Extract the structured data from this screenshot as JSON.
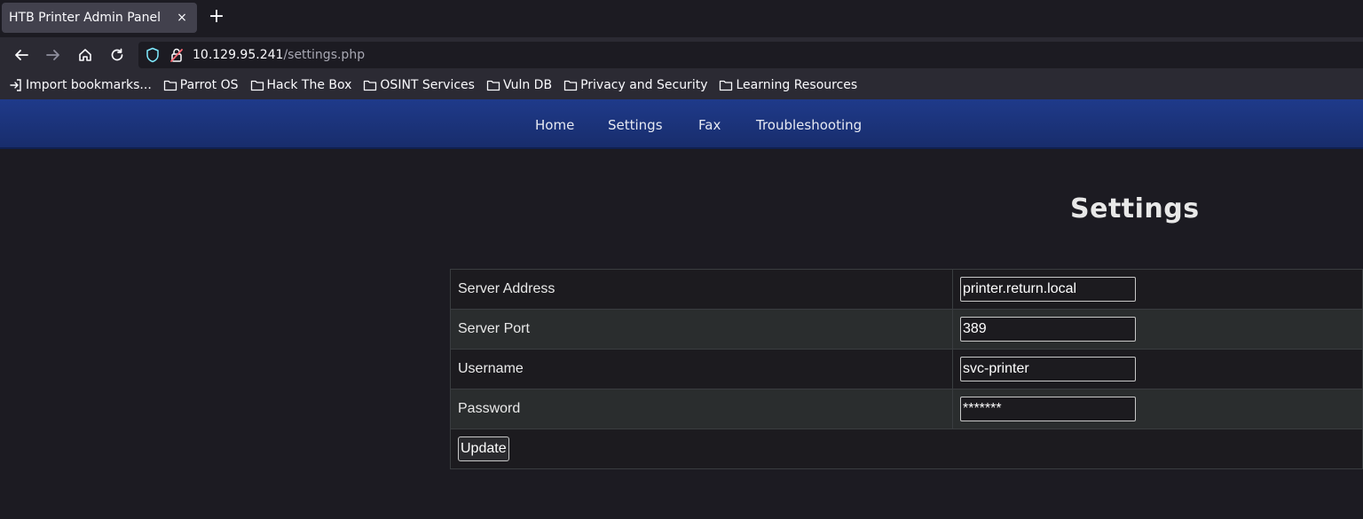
{
  "browser": {
    "tab_title": "HTB Printer Admin Panel",
    "tab_close": "×",
    "new_tab": "+",
    "url_host": "10.129.95.241",
    "url_path": "/settings.php"
  },
  "bookmarks": [
    {
      "label": "Import bookmarks...",
      "icon": "import-icon"
    },
    {
      "label": "Parrot OS",
      "icon": "folder-icon"
    },
    {
      "label": "Hack The Box",
      "icon": "folder-icon"
    },
    {
      "label": "OSINT Services",
      "icon": "folder-icon"
    },
    {
      "label": "Vuln DB",
      "icon": "folder-icon"
    },
    {
      "label": "Privacy and Security",
      "icon": "folder-icon"
    },
    {
      "label": "Learning Resources",
      "icon": "folder-icon"
    }
  ],
  "site_nav": {
    "home": "Home",
    "settings": "Settings",
    "fax": "Fax",
    "troubleshooting": "Troubleshooting"
  },
  "page": {
    "title": "Settings"
  },
  "form": {
    "rows": [
      {
        "label": "Server Address",
        "value": "printer.return.local",
        "type": "text"
      },
      {
        "label": "Server Port",
        "value": "389",
        "type": "text"
      },
      {
        "label": "Username",
        "value": "svc-printer",
        "type": "text"
      },
      {
        "label": "Password",
        "value": "*******",
        "type": "password"
      }
    ],
    "submit_label": "Update"
  },
  "colors": {
    "header_blue": "#1f3a8a",
    "page_bg": "#1c1b22",
    "row_alt": "#2a2d2e"
  }
}
